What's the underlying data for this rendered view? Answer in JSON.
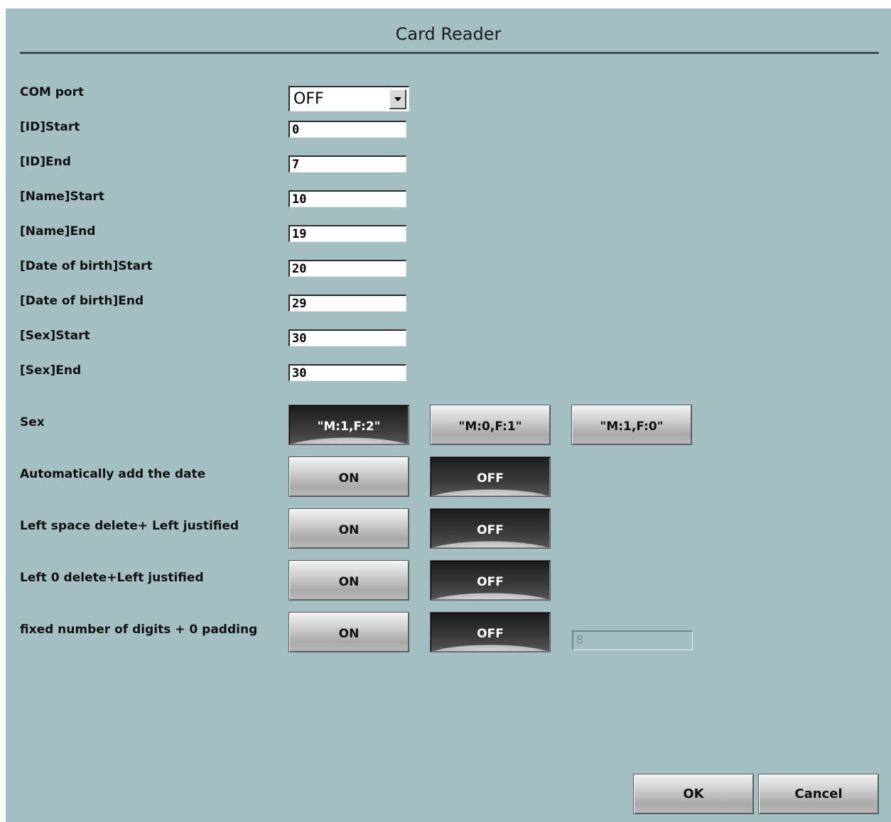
{
  "dialog": {
    "title": "Card Reader"
  },
  "com_port": {
    "label": "COM port",
    "selected": "OFF"
  },
  "fields": {
    "id_start": {
      "label": "[ID]Start",
      "value": "0"
    },
    "id_end": {
      "label": "[ID]End",
      "value": "7"
    },
    "name_start": {
      "label": "[Name]Start",
      "value": "10"
    },
    "name_end": {
      "label": "[Name]End",
      "value": "19"
    },
    "dob_start": {
      "label": "[Date of birth]Start",
      "value": "20"
    },
    "dob_end": {
      "label": "[Date of birth]End",
      "value": "29"
    },
    "sex_start": {
      "label": "[Sex]Start",
      "value": "30"
    },
    "sex_end": {
      "label": "[Sex]End",
      "value": "30"
    }
  },
  "sex": {
    "label": "Sex",
    "options": [
      "\"M:1,F:2\"",
      "\"M:0,F:1\"",
      "\"M:1,F:0\""
    ],
    "selected": "\"M:1,F:2\""
  },
  "auto_date": {
    "label": "Automatically add the date",
    "on": "ON",
    "off": "OFF",
    "selected": "OFF"
  },
  "left_space": {
    "label": "Left space delete+ Left justified",
    "on": "ON",
    "off": "OFF",
    "selected": "OFF"
  },
  "left_zero": {
    "label": "Left 0 delete+Left justified",
    "on": "ON",
    "off": "OFF",
    "selected": "OFF"
  },
  "fixed_digits": {
    "label": "fixed number of digits + 0 padding",
    "on": "ON",
    "off": "OFF",
    "selected": "OFF",
    "digits_value": "8"
  },
  "footer": {
    "ok": "OK",
    "cancel": "Cancel"
  }
}
